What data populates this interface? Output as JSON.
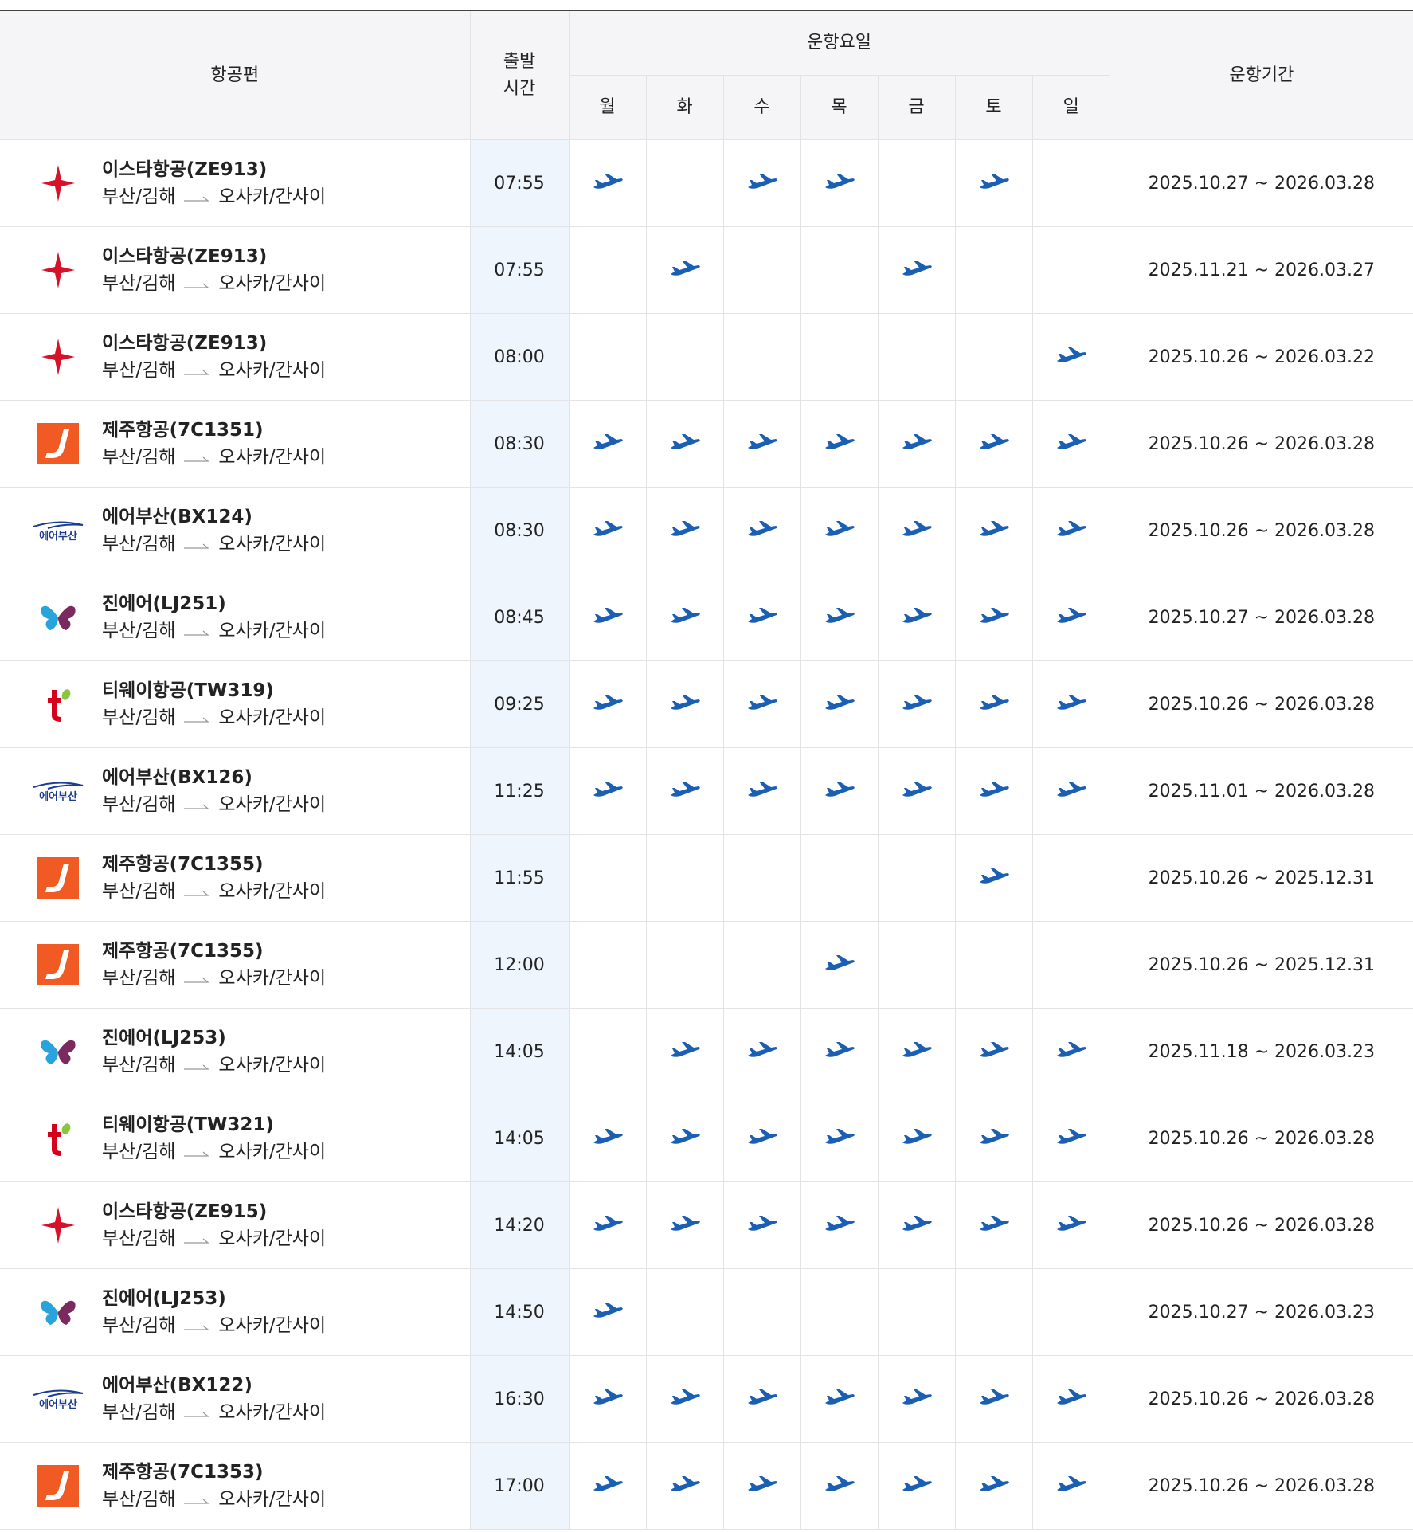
{
  "header": {
    "flight": "항공편",
    "depart_time": "출발\n시간",
    "days_group": "운항요일",
    "period": "운항기간",
    "days": [
      "월",
      "화",
      "수",
      "목",
      "금",
      "토",
      "일"
    ]
  },
  "route": {
    "from": "부산/김해",
    "to": "오사카/간사이"
  },
  "airline_logos": {
    "eastar": "eastar-star-icon",
    "jeju": "jeju-air-logo",
    "airbusan": "air-busan-logo",
    "jinair": "jin-air-butterfly-logo",
    "tway": "tway-logo"
  },
  "colors": {
    "plane": "#1a5fb4",
    "eastar": "#d8112a",
    "jeju": "#f15a22",
    "airbusan": "#1b3d8f",
    "tway": "#d6001c",
    "time_bg": "#eef5fd",
    "header_bg": "#f5f5f7"
  },
  "rows": [
    {
      "airline": "eastar",
      "name": "이스타항공(ZE913)",
      "time": "07:55",
      "days": [
        1,
        0,
        1,
        1,
        0,
        1,
        0
      ],
      "period": "2025.10.27 ~ 2026.03.28"
    },
    {
      "airline": "eastar",
      "name": "이스타항공(ZE913)",
      "time": "07:55",
      "days": [
        0,
        1,
        0,
        0,
        1,
        0,
        0
      ],
      "period": "2025.11.21 ~ 2026.03.27"
    },
    {
      "airline": "eastar",
      "name": "이스타항공(ZE913)",
      "time": "08:00",
      "days": [
        0,
        0,
        0,
        0,
        0,
        0,
        1
      ],
      "period": "2025.10.26 ~ 2026.03.22"
    },
    {
      "airline": "jeju",
      "name": "제주항공(7C1351)",
      "time": "08:30",
      "days": [
        1,
        1,
        1,
        1,
        1,
        1,
        1
      ],
      "period": "2025.10.26 ~ 2026.03.28"
    },
    {
      "airline": "airbusan",
      "name": "에어부산(BX124)",
      "time": "08:30",
      "days": [
        1,
        1,
        1,
        1,
        1,
        1,
        1
      ],
      "period": "2025.10.26 ~ 2026.03.28"
    },
    {
      "airline": "jinair",
      "name": "진에어(LJ251)",
      "time": "08:45",
      "days": [
        1,
        1,
        1,
        1,
        1,
        1,
        1
      ],
      "period": "2025.10.27 ~ 2026.03.28"
    },
    {
      "airline": "tway",
      "name": "티웨이항공(TW319)",
      "time": "09:25",
      "days": [
        1,
        1,
        1,
        1,
        1,
        1,
        1
      ],
      "period": "2025.10.26 ~ 2026.03.28"
    },
    {
      "airline": "airbusan",
      "name": "에어부산(BX126)",
      "time": "11:25",
      "days": [
        1,
        1,
        1,
        1,
        1,
        1,
        1
      ],
      "period": "2025.11.01 ~ 2026.03.28"
    },
    {
      "airline": "jeju",
      "name": "제주항공(7C1355)",
      "time": "11:55",
      "days": [
        0,
        0,
        0,
        0,
        0,
        1,
        0
      ],
      "period": "2025.10.26 ~ 2025.12.31"
    },
    {
      "airline": "jeju",
      "name": "제주항공(7C1355)",
      "time": "12:00",
      "days": [
        0,
        0,
        0,
        1,
        0,
        0,
        0
      ],
      "period": "2025.10.26 ~ 2025.12.31"
    },
    {
      "airline": "jinair",
      "name": "진에어(LJ253)",
      "time": "14:05",
      "days": [
        0,
        1,
        1,
        1,
        1,
        1,
        1
      ],
      "period": "2025.11.18 ~ 2026.03.23"
    },
    {
      "airline": "tway",
      "name": "티웨이항공(TW321)",
      "time": "14:05",
      "days": [
        1,
        1,
        1,
        1,
        1,
        1,
        1
      ],
      "period": "2025.10.26 ~ 2026.03.28"
    },
    {
      "airline": "eastar",
      "name": "이스타항공(ZE915)",
      "time": "14:20",
      "days": [
        1,
        1,
        1,
        1,
        1,
        1,
        1
      ],
      "period": "2025.10.26 ~ 2026.03.28"
    },
    {
      "airline": "jinair",
      "name": "진에어(LJ253)",
      "time": "14:50",
      "days": [
        1,
        0,
        0,
        0,
        0,
        0,
        0
      ],
      "period": "2025.10.27 ~ 2026.03.23"
    },
    {
      "airline": "airbusan",
      "name": "에어부산(BX122)",
      "time": "16:30",
      "days": [
        1,
        1,
        1,
        1,
        1,
        1,
        1
      ],
      "period": "2025.10.26 ~ 2026.03.28"
    },
    {
      "airline": "jeju",
      "name": "제주항공(7C1353)",
      "time": "17:00",
      "days": [
        1,
        1,
        1,
        1,
        1,
        1,
        1
      ],
      "period": "2025.10.26 ~ 2026.03.28"
    }
  ]
}
